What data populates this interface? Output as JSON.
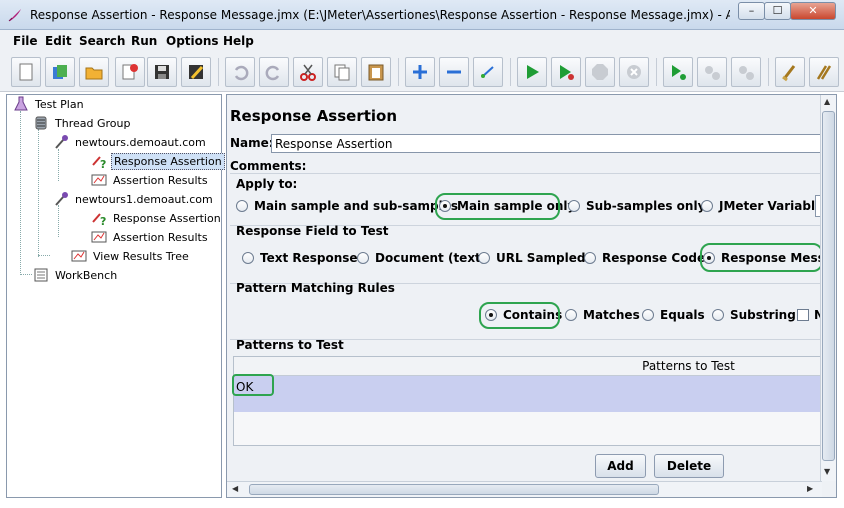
{
  "window": {
    "title": "Response Assertion - Response Message.jmx (E:\\JMeter\\Assertiones\\Response Assertion - Response Message.jmx) - Apache JMeter",
    "minimize": "–",
    "maximize": "☐",
    "close": "✕"
  },
  "menu": [
    "File",
    "Edit",
    "Search",
    "Run",
    "Options",
    "Help"
  ],
  "toolbar": [
    "new-icon",
    "templates-icon",
    "open-icon",
    "close-icon",
    "save-icon",
    "save-as-icon",
    "undo-icon",
    "redo-icon",
    "cut-icon",
    "copy-icon",
    "paste-icon",
    "expand-icon",
    "collapse-icon",
    "toggle-icon",
    "start-icon",
    "start-no-pause-icon",
    "stop-icon",
    "shutdown-icon",
    "remote-start-icon",
    "remote-stop-icon",
    "remote-shutdown-icon",
    "clear-icon",
    "clear-all-icon"
  ],
  "tree": {
    "nodes": [
      {
        "label": "Test Plan"
      },
      {
        "label": "Thread Group"
      },
      {
        "label": "newtours.demoaut.com"
      },
      {
        "label": "Response Assertion"
      },
      {
        "label": "Assertion Results"
      },
      {
        "label": "newtours1.demoaut.com"
      },
      {
        "label": "Response Assertion"
      },
      {
        "label": "Assertion Results"
      },
      {
        "label": "View Results Tree"
      },
      {
        "label": "WorkBench"
      }
    ]
  },
  "panel": {
    "title": "Response Assertion",
    "name_label": "Name:",
    "name_value": "Response Assertion",
    "comments_label": "Comments:",
    "apply_to": {
      "title": "Apply to:",
      "options": [
        "Main sample and sub-samples",
        "Main sample only",
        "Sub-samples only",
        "JMeter Variable"
      ],
      "selected": "Main sample only"
    },
    "response_field": {
      "title": "Response Field to Test",
      "options": [
        "Text Response",
        "Document (text)",
        "URL Sampled",
        "Response Code",
        "Response Message"
      ],
      "selected": "Response Message",
      "visible_last": "Response Messa"
    },
    "pattern_rules": {
      "title": "Pattern Matching Rules",
      "options": [
        "Contains",
        "Matches",
        "Equals",
        "Substring"
      ],
      "selected": "Contains",
      "not_label": "N"
    },
    "patterns": {
      "title": "Patterns to Test",
      "column": "Patterns to Test",
      "rows": [
        "OK"
      ]
    },
    "buttons": {
      "add": "Add",
      "delete": "Delete"
    }
  },
  "colors": {
    "highlight": "#2ea44f",
    "selected_row": "#c9cff0"
  }
}
